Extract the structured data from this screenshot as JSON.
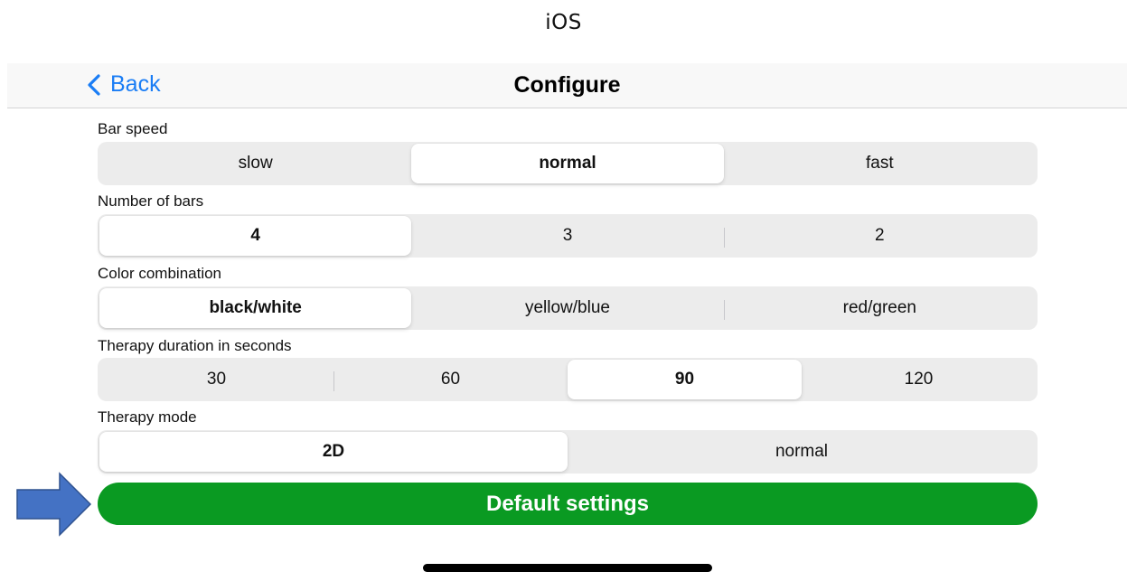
{
  "caption": "iOS",
  "nav": {
    "back_label": "Back",
    "title": "Configure"
  },
  "sections": {
    "bar_speed": {
      "label": "Bar speed",
      "options": [
        "slow",
        "normal",
        "fast"
      ],
      "selected": "normal"
    },
    "number_of_bars": {
      "label": "Number of bars",
      "options": [
        "4",
        "3",
        "2"
      ],
      "selected": "4"
    },
    "color_combination": {
      "label": "Color combination",
      "options": [
        "black/white",
        "yellow/blue",
        "red/green"
      ],
      "selected": "black/white"
    },
    "therapy_duration": {
      "label": "Therapy duration in seconds",
      "options": [
        "30",
        "60",
        "90",
        "120"
      ],
      "selected": "90"
    },
    "therapy_mode": {
      "label": "Therapy mode",
      "options": [
        "2D",
        "normal"
      ],
      "selected": "2D"
    }
  },
  "default_button": {
    "label": "Default settings",
    "color": "#0a9a22"
  },
  "colors": {
    "accent": "#1a7df5",
    "arrow": "#4472c4"
  }
}
